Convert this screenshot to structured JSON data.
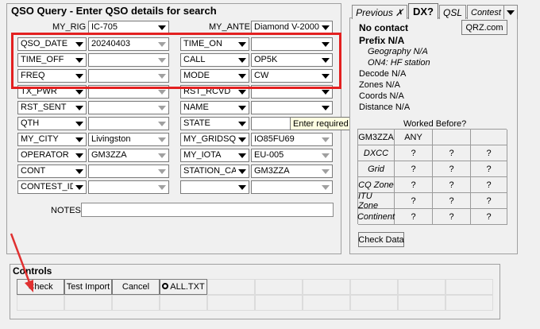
{
  "query": {
    "title": "QSO Query - Enter QSO details for search",
    "my_rig_label": "MY_RIG",
    "my_rig_value": "IC-705",
    "my_antenna_label": "MY_ANTENNA",
    "my_antenna_value": "Diamond V-2000",
    "rows": [
      {
        "f1": "QSO_DATE",
        "v1": "20240403",
        "f2": "TIME_ON",
        "v2": ""
      },
      {
        "f1": "TIME_OFF",
        "v1": "",
        "f2": "CALL",
        "v2": "OP5K"
      },
      {
        "f1": "FREQ",
        "v1": "",
        "f2": "MODE",
        "v2": "CW"
      },
      {
        "f1": "TX_PWR",
        "v1": "",
        "f2": "RST_RCVD",
        "v2": ""
      },
      {
        "f1": "RST_SENT",
        "v1": "",
        "f2": "NAME",
        "v2": ""
      },
      {
        "f1": "QTH",
        "v1": "",
        "f2": "STATE",
        "v2": ""
      },
      {
        "f1": "MY_CITY",
        "v1": "Livingston",
        "f2": "MY_GRIDSQ",
        "v2": "IO85FU69"
      },
      {
        "f1": "OPERATOR",
        "v1": "GM3ZZA",
        "f2": "MY_IOTA",
        "v2": "EU-005"
      },
      {
        "f1": "CONT",
        "v1": "",
        "f2": "STATION_CA",
        "v2": "GM3ZZA"
      },
      {
        "f1": "CONTEST_ID",
        "v1": "",
        "f2": "",
        "v2": ""
      }
    ],
    "notes_label": "NOTES",
    "notes_value": "",
    "tooltip": "Enter required value to log"
  },
  "dx": {
    "tabs": [
      "Previous",
      "DX?",
      "QSL",
      "Contest"
    ],
    "no_contact": "No contact",
    "qrz_button": "QRZ.com",
    "prefix": "Prefix N/A",
    "geography": "Geography N/A",
    "on4": "ON4: HF station",
    "decode": "Decode N/A",
    "zones": "Zones N/A",
    "coords": "Coords N/A",
    "distance": "Distance N/A",
    "worked_before": "Worked Before?",
    "wb_header": [
      "GM3ZZA",
      "ANY",
      "",
      ""
    ],
    "wb_rows": [
      {
        "label": "DXCC",
        "values": [
          "?",
          "?",
          "?"
        ]
      },
      {
        "label": "Grid",
        "values": [
          "?",
          "?",
          "?"
        ]
      },
      {
        "label": "CQ Zone",
        "values": [
          "?",
          "?",
          "?"
        ]
      },
      {
        "label": "ITU Zone",
        "values": [
          "?",
          "?",
          "?"
        ]
      },
      {
        "label": "Continent",
        "values": [
          "?",
          "?",
          "?"
        ]
      }
    ],
    "check_data": "Check Data"
  },
  "controls": {
    "title": "Controls",
    "buttons": [
      "Check",
      "Test Import",
      "Cancel",
      "ALL.TXT"
    ]
  },
  "colors": {
    "highlight": "#e32020",
    "arrow": "#e03030",
    "tooltip_bg": "#ffffe1"
  }
}
